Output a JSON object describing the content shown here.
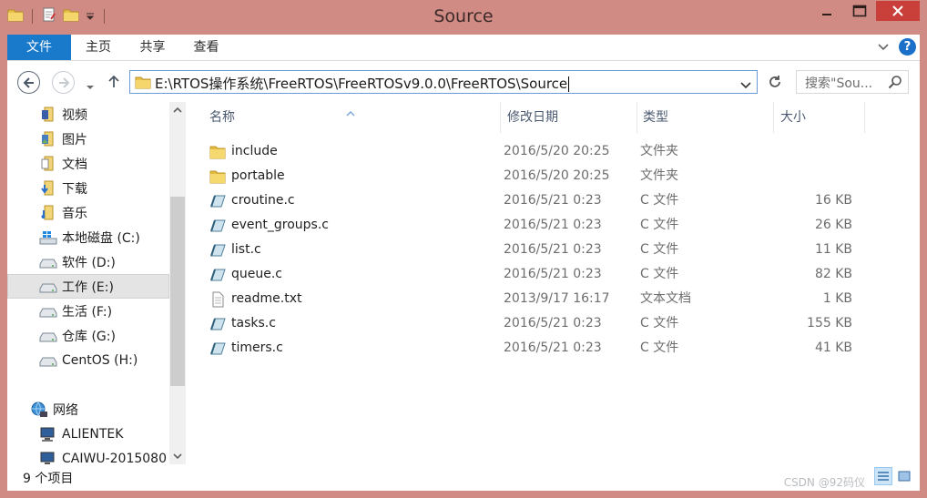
{
  "window": {
    "title": "Source"
  },
  "ribbon": {
    "tabs": [
      {
        "label": "文件"
      },
      {
        "label": "主页"
      },
      {
        "label": "共享"
      },
      {
        "label": "查看"
      }
    ]
  },
  "navigation": {
    "address": "E:\\RTOS操作系统\\FreeRTOS\\FreeRTOSv9.0.0\\FreeRTOS\\Source",
    "search_placeholder": "搜索\"Sou..."
  },
  "sidebar": {
    "items": [
      {
        "label": "视频",
        "icon": "videos-folder-icon"
      },
      {
        "label": "图片",
        "icon": "pictures-folder-icon"
      },
      {
        "label": "文档",
        "icon": "documents-folder-icon"
      },
      {
        "label": "下载",
        "icon": "downloads-folder-icon"
      },
      {
        "label": "音乐",
        "icon": "music-folder-icon"
      },
      {
        "label": "本地磁盘 (C:)",
        "icon": "windows-drive-icon"
      },
      {
        "label": "软件 (D:)",
        "icon": "drive-icon"
      },
      {
        "label": "工作 (E:)",
        "icon": "drive-icon",
        "selected": true
      },
      {
        "label": "生活 (F:)",
        "icon": "drive-icon"
      },
      {
        "label": "仓库 (G:)",
        "icon": "drive-icon"
      },
      {
        "label": "CentOS (H:)",
        "icon": "drive-icon"
      },
      {
        "label": "网络",
        "icon": "network-icon"
      },
      {
        "label": "ALIENTEK",
        "icon": "computer-icon"
      },
      {
        "label": "CAIWU-2015080",
        "icon": "computer-icon"
      }
    ]
  },
  "columns": {
    "name": "名称",
    "date": "修改日期",
    "type": "类型",
    "size": "大小"
  },
  "files": [
    {
      "name": "include",
      "date": "2016/5/20 20:25",
      "type": "文件夹",
      "size": "",
      "icon": "folder-icon"
    },
    {
      "name": "portable",
      "date": "2016/5/20 20:25",
      "type": "文件夹",
      "size": "",
      "icon": "folder-icon"
    },
    {
      "name": "croutine.c",
      "date": "2016/5/21 0:23",
      "type": "C 文件",
      "size": "16 KB",
      "icon": "c-file-icon"
    },
    {
      "name": "event_groups.c",
      "date": "2016/5/21 0:23",
      "type": "C 文件",
      "size": "26 KB",
      "icon": "c-file-icon"
    },
    {
      "name": "list.c",
      "date": "2016/5/21 0:23",
      "type": "C 文件",
      "size": "11 KB",
      "icon": "c-file-icon"
    },
    {
      "name": "queue.c",
      "date": "2016/5/21 0:23",
      "type": "C 文件",
      "size": "82 KB",
      "icon": "c-file-icon"
    },
    {
      "name": "readme.txt",
      "date": "2013/9/17 16:17",
      "type": "文本文档",
      "size": "1 KB",
      "icon": "text-file-icon"
    },
    {
      "name": "tasks.c",
      "date": "2016/5/21 0:23",
      "type": "C 文件",
      "size": "155 KB",
      "icon": "c-file-icon"
    },
    {
      "name": "timers.c",
      "date": "2016/5/21 0:23",
      "type": "C 文件",
      "size": "41 KB",
      "icon": "c-file-icon"
    }
  ],
  "status": {
    "item_count": "9 个项目"
  },
  "watermark": "CSDN @92码仪",
  "colors": {
    "file_tab": "#1979ca",
    "title_bar": "#d08b84",
    "close_button": "#c9403b"
  }
}
